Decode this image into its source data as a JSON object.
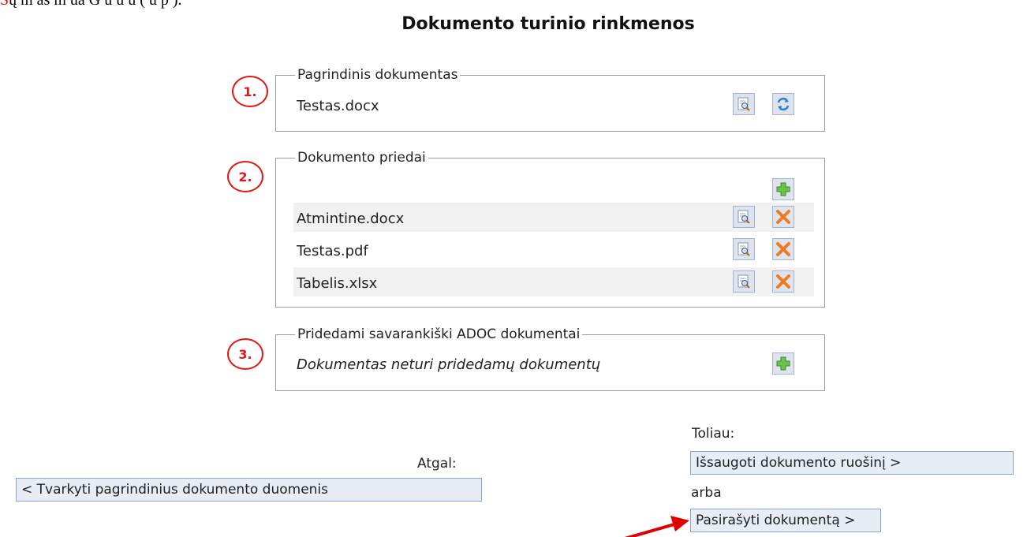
{
  "top_text": {
    "prefix": "S",
    "rest": "ų   m      as       m         ua        G   u    u   u    (  u   p    ).     "
  },
  "title": "Dokumento turinio rinkmenos",
  "sections": {
    "main_doc": {
      "marker": "1.",
      "legend": "Pagrindinis dokumentas",
      "file": "Testas.docx"
    },
    "attachments": {
      "marker": "2.",
      "legend": "Dokumento priedai",
      "files": [
        "Atmintine.docx",
        "Testas.pdf",
        "Tabelis.xlsx"
      ]
    },
    "adoc": {
      "marker": "3.",
      "legend": "Pridedami savarankiški ADOC dokumentai",
      "empty_text": "Dokumentas neturi pridedamų dokumentų"
    }
  },
  "nav": {
    "back_label": "Atgal:",
    "back_button": "< Tvarkyti pagrindinius dokumento duomenis",
    "next_label": "Toliau:",
    "save_button": "Išsaugoti dokumento ruošinį >",
    "or_label": "arba",
    "sign_button": "Pasirašyti dokumentą >"
  },
  "colors": {
    "marker": "#e21818",
    "arrow": "#e00000",
    "button_bg": "#e7ecf5",
    "border": "#9a9a9a"
  },
  "icons": [
    "preview-icon",
    "replace-icon",
    "add-icon",
    "delete-icon"
  ]
}
